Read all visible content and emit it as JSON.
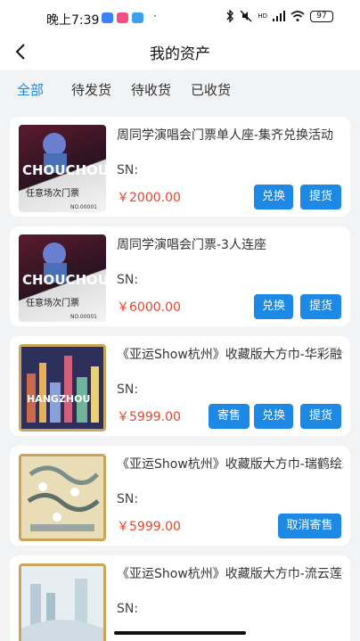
{
  "status_bar": {
    "time": "晚上7:39",
    "dot": "·",
    "network": "HD",
    "battery": "97",
    "icons": [
      "bluetooth-icon",
      "mute-icon",
      "signal-icon",
      "wifi-icon",
      "battery-icon"
    ]
  },
  "nav": {
    "title": "我的资产",
    "back_icon": "chevron-left-icon"
  },
  "tabs": [
    {
      "label": "全部",
      "active": true
    },
    {
      "label": "待发货",
      "active": false
    },
    {
      "label": "待收货",
      "active": false
    },
    {
      "label": "已收货",
      "active": false
    }
  ],
  "items": [
    {
      "title": "周同学演唱会门票单人座-集齐兑换活动",
      "sn": "SN:",
      "price": "￥2000.00",
      "thumb": {
        "brand": "CHOUCHOU",
        "caption": "任意场次门票",
        "number": "NO.00001"
      },
      "buttons": [
        "兑换",
        "提货"
      ]
    },
    {
      "title": "周同学演唱会门票-3人连座",
      "sn": "SN:",
      "price": "￥6000.00",
      "thumb": {
        "brand": "CHOUCHOU",
        "caption": "任意场次门票",
        "number": "NO.00001"
      },
      "buttons": [
        "兑换",
        "提货"
      ]
    },
    {
      "title": "《亚运Show杭州》收藏版大方巾-华彩融创",
      "sn": "SN:",
      "price": "￥5999.00",
      "thumb": {
        "brand": "HANGZHOU"
      },
      "buttons": [
        "寄售",
        "兑换",
        "提货"
      ]
    },
    {
      "title": "《亚运Show杭州》收藏版大方巾-瑞鹤绘彩",
      "sn": "SN:",
      "price": "￥5999.00",
      "buttons": [
        "取消寄售"
      ]
    },
    {
      "title": "《亚运Show杭州》收藏版大方巾-流云莲开",
      "sn": "SN:",
      "price": "",
      "buttons": []
    }
  ],
  "colors": {
    "accent": "#1e88e5",
    "price": "#e4462c",
    "background": "#f2f3f5"
  }
}
